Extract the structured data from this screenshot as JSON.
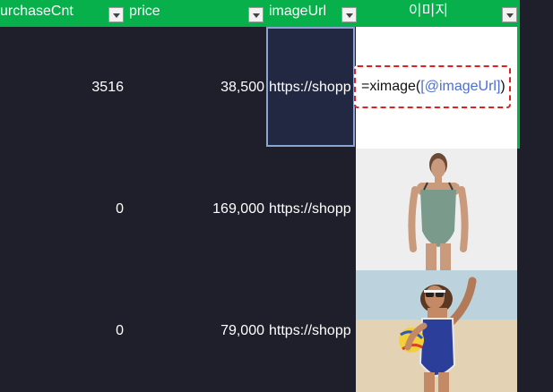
{
  "header": {
    "col_purchase": "urchaseCnt",
    "col_price": "price",
    "col_imageurl": "imageUrl",
    "col_image": "이미지"
  },
  "rows": [
    {
      "purchaseCnt": "3516",
      "price": "38,500",
      "imageUrl": "https://shopp"
    },
    {
      "purchaseCnt": "0",
      "price": "169,000",
      "imageUrl": "https://shopp"
    },
    {
      "purchaseCnt": "0",
      "price": "79,000",
      "imageUrl": "https://shopp"
    }
  ],
  "formula": {
    "prefix": "=ximage(",
    "argument": "[@imageUrl]",
    "suffix": ")"
  },
  "colors": {
    "header_bg": "#08b04b",
    "sheet_bg": "#1f1e2b",
    "highlight_border": "#e02020"
  },
  "icons": {
    "filter": "filter-dropdown-icon"
  }
}
